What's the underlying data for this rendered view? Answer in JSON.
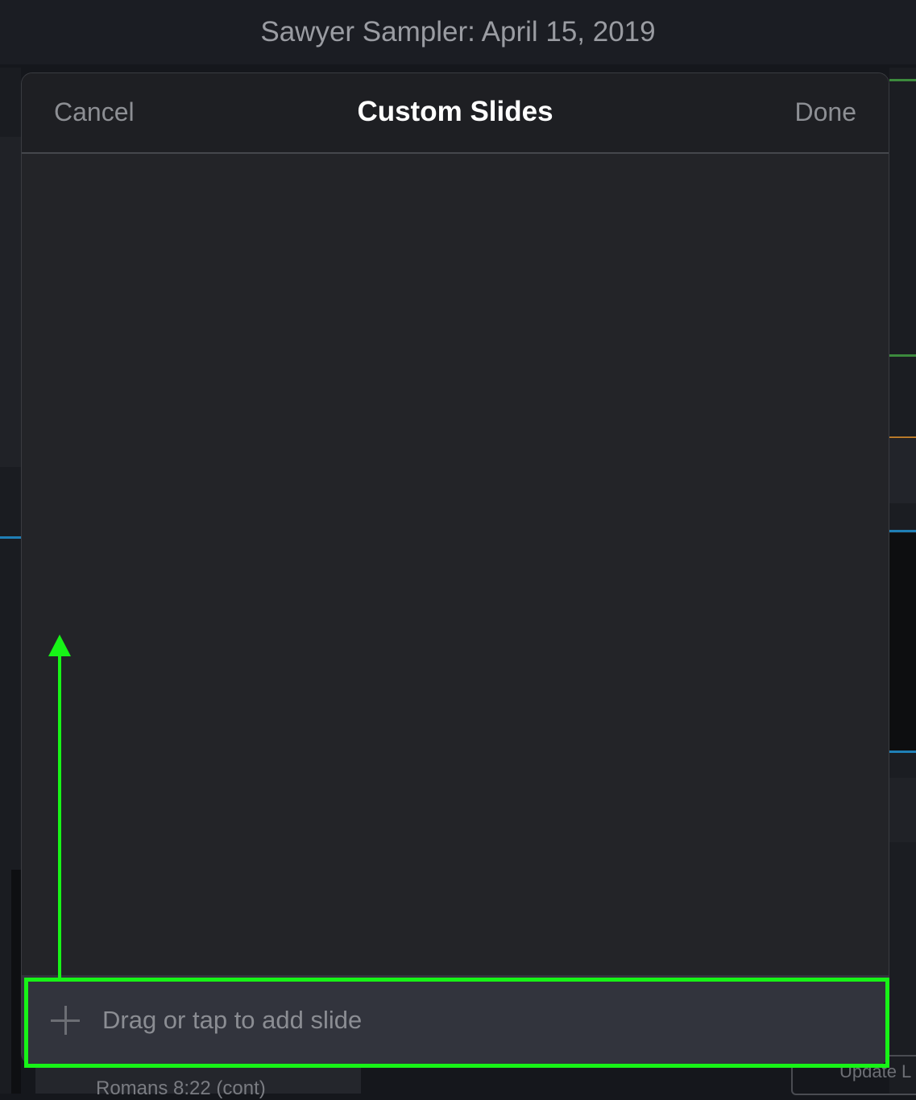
{
  "window": {
    "title": "Sawyer Sampler: April 15, 2019"
  },
  "modal": {
    "title": "Custom Slides",
    "cancel_label": "Cancel",
    "done_label": "Done",
    "add_slide_label": "Drag or tap to add slide",
    "add_slide_icon": "plus-icon"
  },
  "background": {
    "update_button_label": "Update L",
    "list_item_label": "Romans 8:22 (cont)"
  },
  "annotation": {
    "color": "#17f317"
  }
}
